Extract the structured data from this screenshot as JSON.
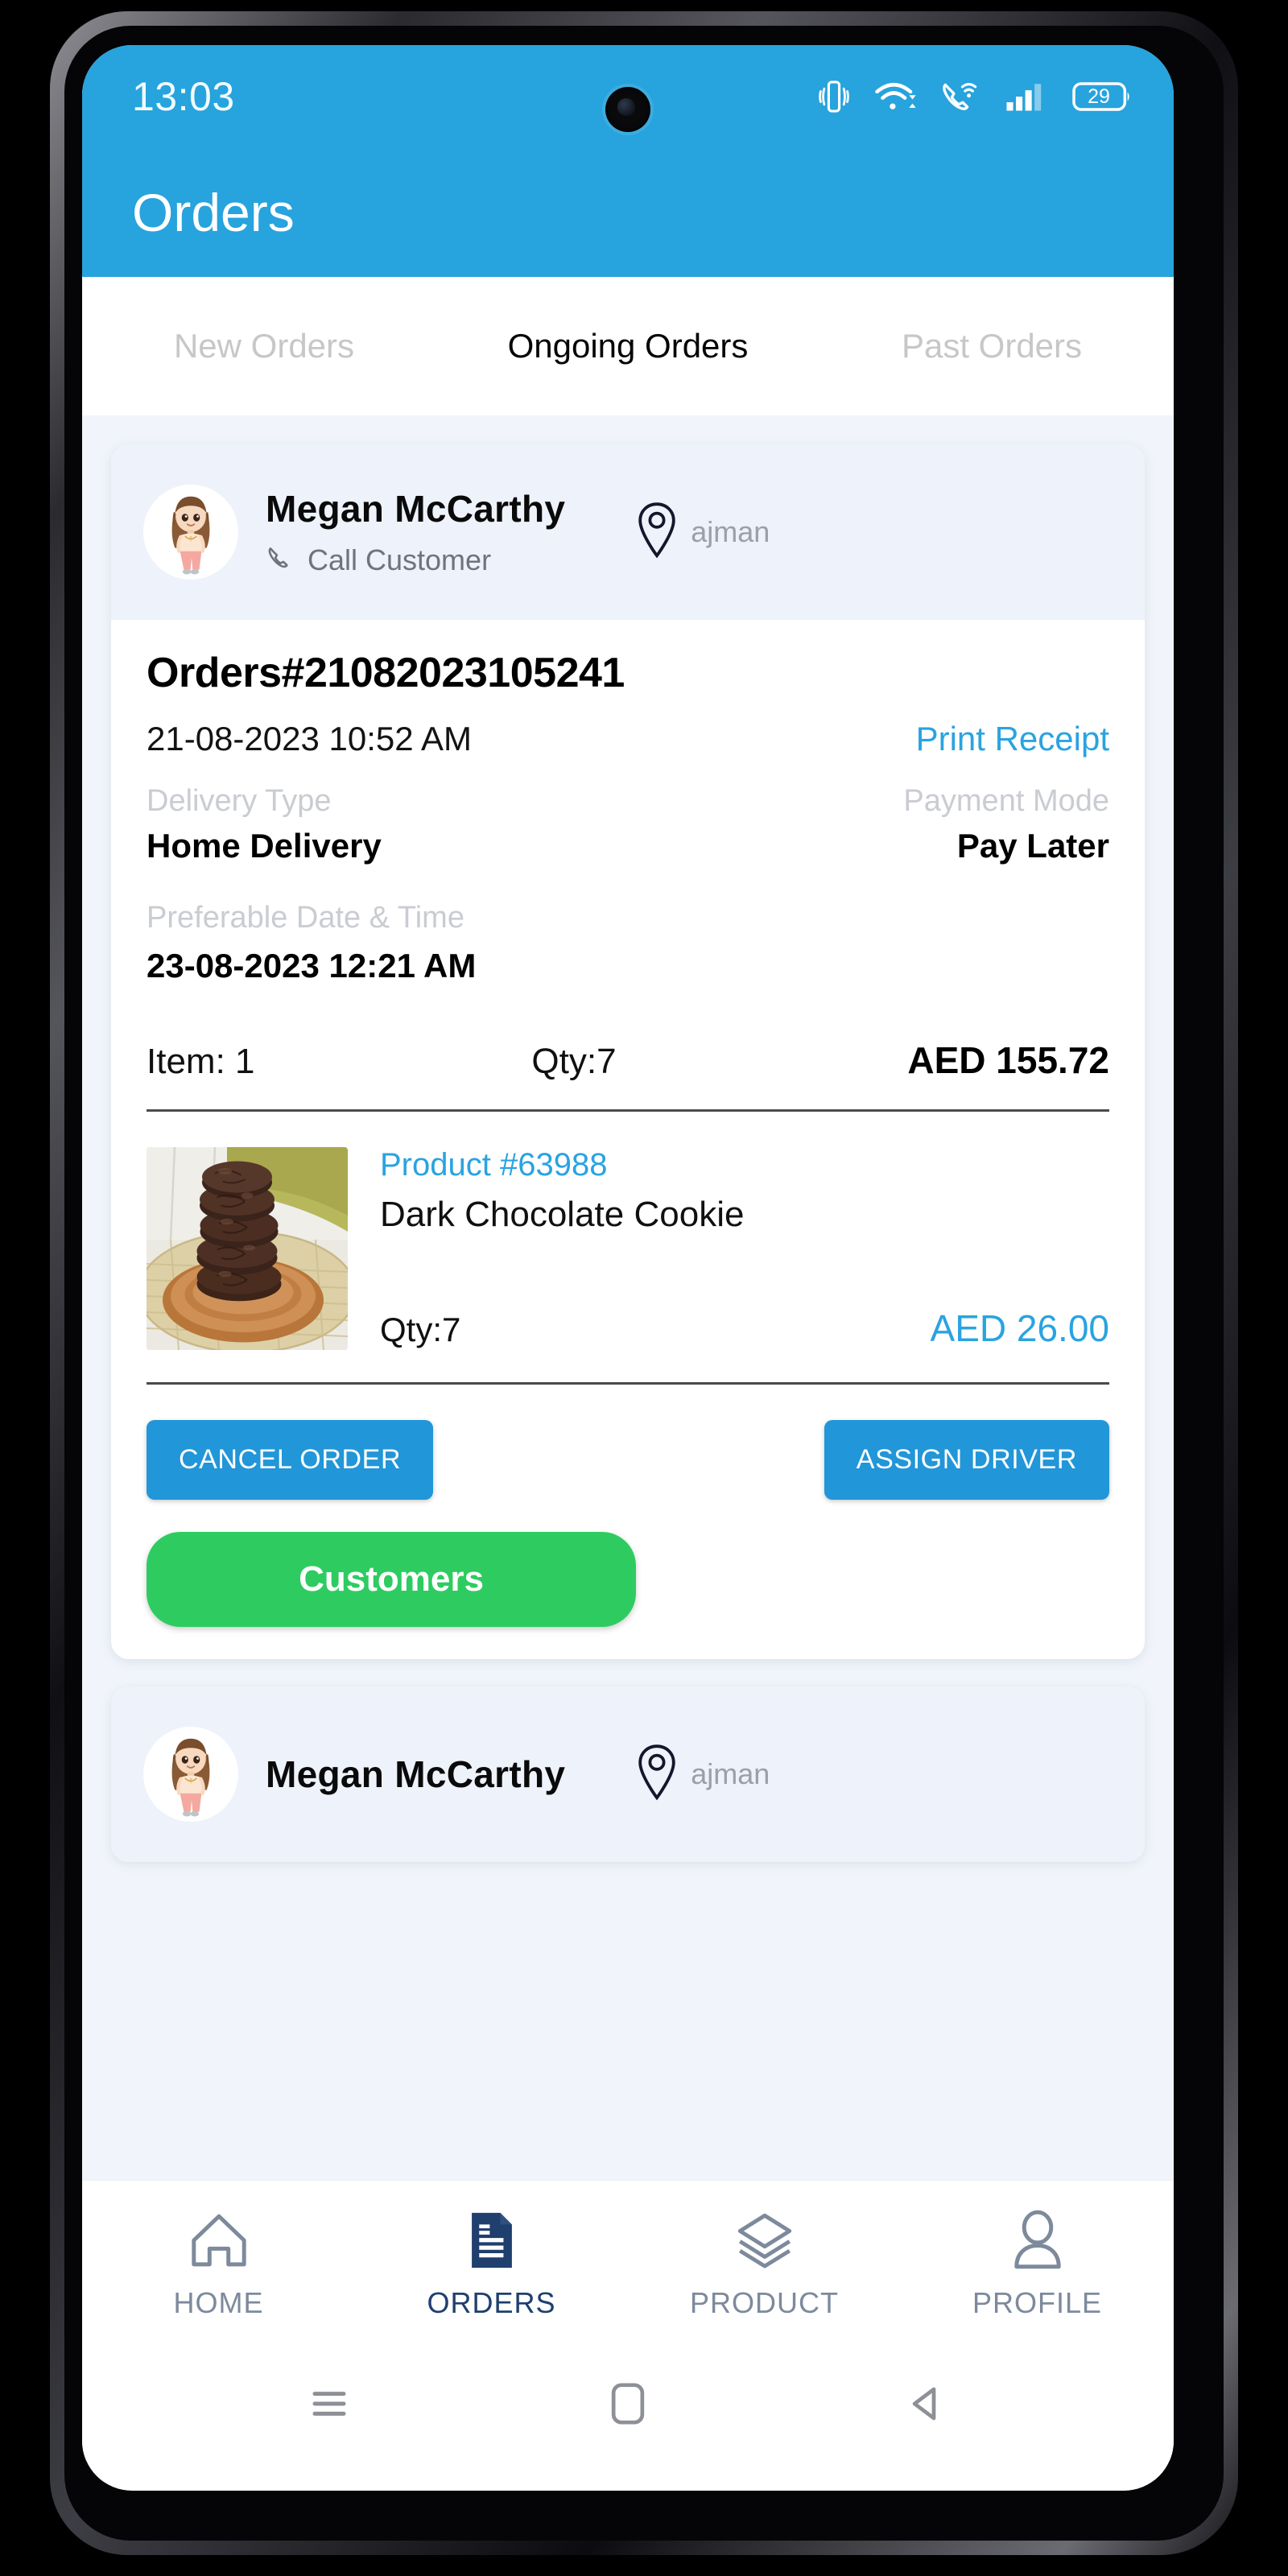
{
  "status_bar": {
    "time": "13:03",
    "battery_level": "29",
    "icons": [
      "vibrate-icon",
      "wifi-icon",
      "wifi-calling-icon",
      "cellular-signal-icon",
      "battery-icon"
    ]
  },
  "app_bar": {
    "title": "Orders",
    "background_color": "#27a3dd"
  },
  "tabs": [
    {
      "label": "New Orders",
      "active": false
    },
    {
      "label": "Ongoing Orders",
      "active": true
    },
    {
      "label": "Past Orders",
      "active": false
    }
  ],
  "orders": [
    {
      "customer": {
        "name": "Megan  McCarthy",
        "call_label": "Call Customer",
        "location": "ajman"
      },
      "order_number": "Orders#21082023105241",
      "order_date": "21-08-2023 10:52 AM",
      "print_receipt": "Print Receipt",
      "delivery_type_label": "Delivery Type",
      "delivery_type_value": "Home Delivery",
      "payment_mode_label": "Payment Mode",
      "payment_mode_value": "Pay Later",
      "preferable_label": "Preferable Date & Time",
      "preferable_value": "23-08-2023 12:21 AM",
      "summary": {
        "item": "Item: 1",
        "qty": "Qty:7",
        "amount": "AED 155.72"
      },
      "product": {
        "id": "Product #63988",
        "name": "Dark Chocolate Cookie",
        "qty": "Qty:7",
        "price": "AED 26.00"
      },
      "buttons": {
        "cancel": "CANCEL ORDER",
        "assign": "ASSIGN DRIVER",
        "customers": "Customers"
      }
    },
    {
      "customer": {
        "name": "Megan  McCarthy",
        "call_label": "",
        "location": "ajman"
      }
    }
  ],
  "bottom_nav": [
    {
      "label": "HOME",
      "icon": "home-icon",
      "active": false
    },
    {
      "label": "ORDERS",
      "icon": "document-icon",
      "active": true
    },
    {
      "label": "PRODUCT",
      "icon": "layers-icon",
      "active": false
    },
    {
      "label": "PROFILE",
      "icon": "person-icon",
      "active": false
    }
  ],
  "system_nav": [
    {
      "icon": "recents-icon"
    },
    {
      "icon": "home-square-icon"
    },
    {
      "icon": "back-triangle-icon"
    }
  ],
  "colors": {
    "accent_blue": "#27a3dd",
    "link_blue": "#2aa3e0",
    "button_blue": "#2196d8",
    "green": "#2ecc60",
    "nav_active": "#1f3f6e",
    "page_bg": "#f1f5fb"
  }
}
